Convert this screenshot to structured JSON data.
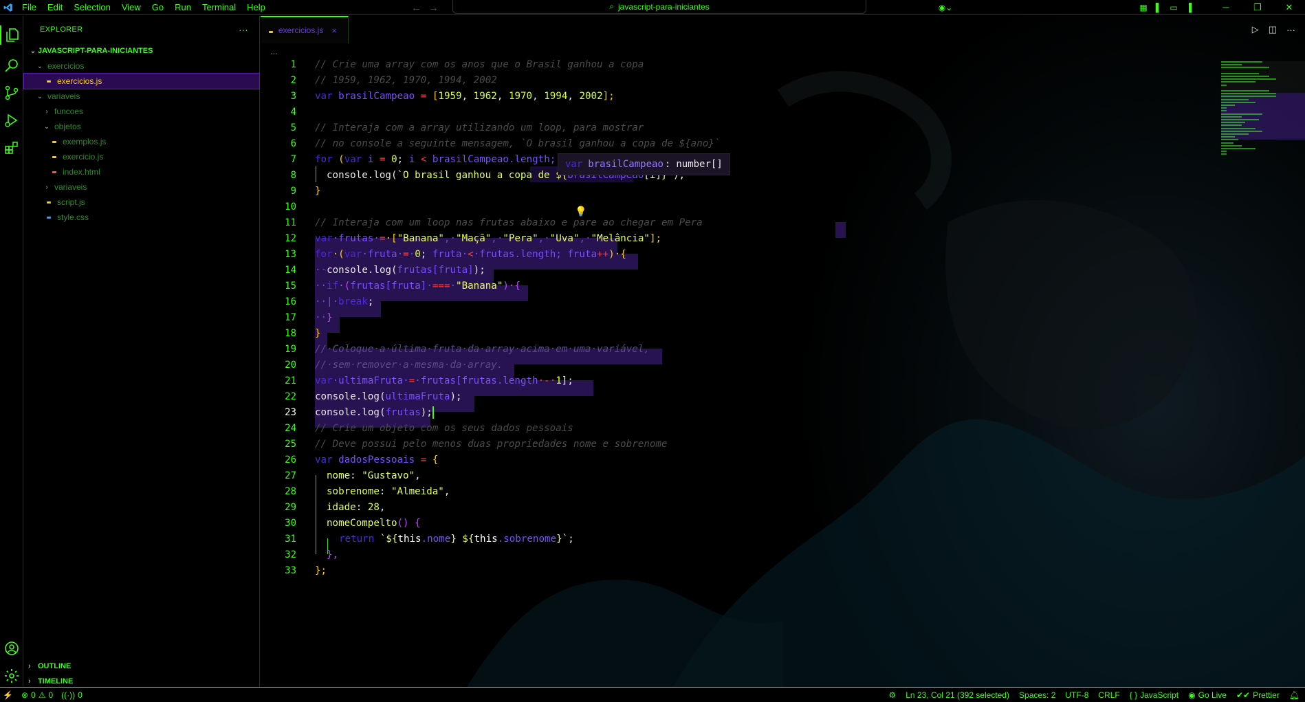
{
  "menu": [
    "File",
    "Edit",
    "Selection",
    "View",
    "Go",
    "Run",
    "Terminal",
    "Help"
  ],
  "command_center": {
    "text": "javascript-para-iniciantes"
  },
  "explorer": {
    "title": "EXPLORER",
    "more": "···",
    "project": "JAVASCRIPT-PARA-INICIANTES",
    "tree": [
      {
        "label": "exercicios",
        "type": "folder-open",
        "depth": 1
      },
      {
        "label": "exercicios.js",
        "type": "js",
        "depth": 2,
        "selected": true
      },
      {
        "label": "variaveis",
        "type": "folder-open",
        "depth": 1
      },
      {
        "label": "funcoes",
        "type": "folder",
        "depth": 2
      },
      {
        "label": "objetos",
        "type": "folder-open",
        "depth": 2
      },
      {
        "label": "exemplos.js",
        "type": "js",
        "depth": 3
      },
      {
        "label": "exercicio.js",
        "type": "js",
        "depth": 3
      },
      {
        "label": "index.html",
        "type": "html",
        "depth": 3
      },
      {
        "label": "variaveis",
        "type": "folder",
        "depth": 2
      },
      {
        "label": "script.js",
        "type": "js",
        "depth": 2
      },
      {
        "label": "style.css",
        "type": "css",
        "depth": 2
      }
    ],
    "outline": "OUTLINE",
    "timeline": "TIMELINE"
  },
  "tab": {
    "label": "exercicios.js",
    "close": "×"
  },
  "breadcrumb": "...",
  "hover_tooltip": {
    "kw": "var",
    "name": "brasilCampeao",
    "type": "number[]"
  },
  "colors": {
    "accent": "#39ff14",
    "keyword": "#4a2bd6",
    "selection": "#482296"
  },
  "status": {
    "errors": "0",
    "warnings": "0",
    "ports": "0",
    "position": "Ln 23, Col 21 (392 selected)",
    "spaces": "Spaces: 2",
    "encoding": "UTF-8",
    "eol": "CRLF",
    "language": "JavaScript",
    "golive": "Go Live",
    "prettier": "Prettier"
  },
  "code_lines": [
    {
      "n": "1"
    },
    {
      "n": "2"
    },
    {
      "n": "3"
    },
    {
      "n": "4"
    },
    {
      "n": "5"
    },
    {
      "n": "6"
    },
    {
      "n": "7"
    },
    {
      "n": "8"
    },
    {
      "n": "9"
    },
    {
      "n": "10"
    },
    {
      "n": "11"
    },
    {
      "n": "12"
    },
    {
      "n": "13"
    },
    {
      "n": "14"
    },
    {
      "n": "15"
    },
    {
      "n": "16"
    },
    {
      "n": "17"
    },
    {
      "n": "18"
    },
    {
      "n": "19"
    },
    {
      "n": "20"
    },
    {
      "n": "21"
    },
    {
      "n": "22"
    },
    {
      "n": "23"
    },
    {
      "n": "24"
    },
    {
      "n": "25"
    },
    {
      "n": "26"
    },
    {
      "n": "27"
    },
    {
      "n": "28"
    },
    {
      "n": "29"
    },
    {
      "n": "30"
    },
    {
      "n": "31"
    },
    {
      "n": "32"
    },
    {
      "n": "33"
    }
  ],
  "code": {
    "l1": "// Crie uma array com os anos que o Brasil ganhou a copa",
    "l2": "// 1959, 1962, 1970, 1994, 2002",
    "l3": [
      "var",
      "brasilCampeao",
      "=",
      "[",
      "1959",
      ", ",
      "1962",
      ", ",
      "1970",
      ", ",
      "1994",
      ", ",
      "2002",
      "];"
    ],
    "l5": "// Interaja com a array utilizando um loop, para mostrar",
    "l6": "// no console a seguinte mensagem, `O brasil ganhou a copa de ${ano}`",
    "l7": [
      "for",
      "(",
      "var",
      "i",
      "=",
      "0",
      "; ",
      "i",
      "<",
      "brasilCampeao",
      ".length; ",
      "i"
    ],
    "l8": [
      "console",
      ".log(",
      "`O brasil ganhou a copa de ${",
      "brasilCampeao",
      "[i]",
      "}`",
      ");"
    ],
    "l9": "}",
    "l11": "// Interaja com um loop nas frutas abaixo e pare ao chegar em Pera",
    "l12": [
      "var",
      "·frutas·",
      "=",
      "·[",
      "\"Banana\"",
      ",·",
      "\"Maçã\"",
      ",·",
      "\"Pera\"",
      ",·",
      "\"Uva\"",
      ",·",
      "\"Melância\"",
      "];"
    ],
    "l13": [
      "for",
      "·(",
      "var",
      "·fruta·",
      "=",
      "·",
      "0",
      "; ",
      "fruta·",
      "<",
      "·frutas",
      ".length; ",
      "fruta",
      "++",
      ")·{"
    ],
    "l14": [
      "··",
      "console",
      ".log(",
      "frutas",
      "[fruta]",
      ");"
    ],
    "l15": [
      "··",
      "if",
      "·(",
      "frutas",
      "[fruta]",
      "·",
      "===",
      "·",
      "\"Banana\"",
      ")·{"
    ],
    "l16": [
      "··|·",
      "break",
      ";"
    ],
    "l17": [
      "··",
      "}"
    ],
    "l18": "}",
    "l19": "//·Coloque·a·última·fruta·da·array·acima·em·uma·variável,",
    "l20": "//·sem·remover·a·mesma·da·array.",
    "l21": [
      "var",
      "·ultimaFruta·",
      "=",
      "·frutas",
      "[frutas",
      ".length",
      "·-·",
      "1",
      "];"
    ],
    "l22": [
      "console",
      ".log(",
      "ultimaFruta",
      ");"
    ],
    "l23": [
      "console",
      ".log(",
      "frutas",
      ");"
    ],
    "l24": "// Crie um objeto com os seus dados pessoais",
    "l25": "// Deve possui pelo menos duas propriedades nome e sobrenome",
    "l26": [
      "var",
      "dadosPessoais",
      "=",
      "{"
    ],
    "l27": [
      "nome",
      ": ",
      "\"Gustavo\"",
      ","
    ],
    "l28": [
      "sobrenome",
      ": ",
      "\"Almeida\"",
      ","
    ],
    "l29": [
      "idade",
      ": ",
      "28",
      ","
    ],
    "l30": [
      "nomeCompelto",
      "()",
      "{"
    ],
    "l31": [
      "return",
      "`${",
      "this",
      ".nome",
      "}",
      "${",
      "this",
      ".sobrenome",
      "}`",
      ";"
    ],
    "l32": "},",
    "l33": "};"
  }
}
